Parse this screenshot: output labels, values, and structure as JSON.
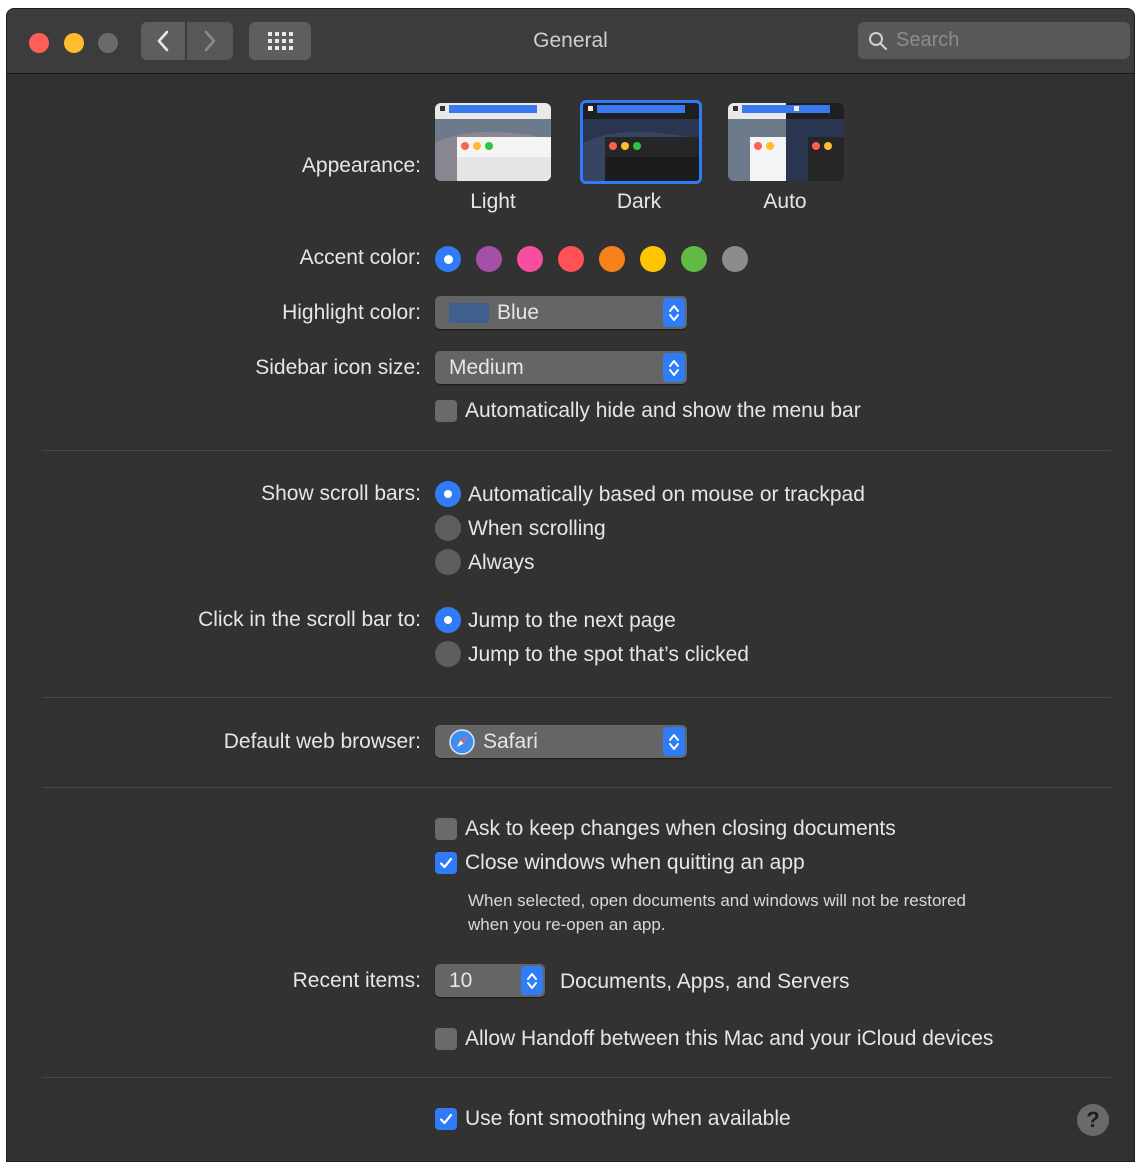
{
  "window": {
    "title": "General",
    "search_placeholder": "Search"
  },
  "appearance": {
    "label": "Appearance:",
    "options": [
      {
        "name": "Light",
        "selected": false
      },
      {
        "name": "Dark",
        "selected": true
      },
      {
        "name": "Auto",
        "selected": false
      }
    ]
  },
  "accent": {
    "label": "Accent color:",
    "colors": [
      "#2f7cf6",
      "#a550a7",
      "#f74f9e",
      "#ff5257",
      "#f7821b",
      "#ffc600",
      "#62ba46",
      "#8c8c8c"
    ],
    "selected_index": 0
  },
  "highlight": {
    "label": "Highlight color:",
    "value": "Blue",
    "swatch_color": "#3f5f8e"
  },
  "sidebar_icon": {
    "label": "Sidebar icon size:",
    "value": "Medium"
  },
  "menu_bar": {
    "label": "Automatically hide and show the menu bar",
    "checked": false
  },
  "scroll_bars": {
    "label": "Show scroll bars:",
    "options": [
      {
        "label": "Automatically based on mouse or trackpad",
        "selected": true
      },
      {
        "label": "When scrolling",
        "selected": false
      },
      {
        "label": "Always",
        "selected": false
      }
    ]
  },
  "click_scroll": {
    "label": "Click in the scroll bar to:",
    "options": [
      {
        "label": "Jump to the next page",
        "selected": true
      },
      {
        "label": "Jump to the spot that’s clicked",
        "selected": false
      }
    ]
  },
  "browser": {
    "label": "Default web browser:",
    "value": "Safari"
  },
  "documents": {
    "ask_keep": {
      "label": "Ask to keep changes when closing documents",
      "checked": false
    },
    "close_windows": {
      "label": "Close windows when quitting an app",
      "checked": true
    },
    "note_line1": "When selected, open documents and windows will not be restored",
    "note_line2": "when you re-open an app."
  },
  "recent": {
    "label": "Recent items:",
    "value": "10",
    "suffix": "Documents, Apps, and Servers"
  },
  "handoff": {
    "label": "Allow Handoff between this Mac and your iCloud devices",
    "checked": false
  },
  "font_smoothing": {
    "label": "Use font smoothing when available",
    "checked": true
  },
  "help_glyph": "?"
}
